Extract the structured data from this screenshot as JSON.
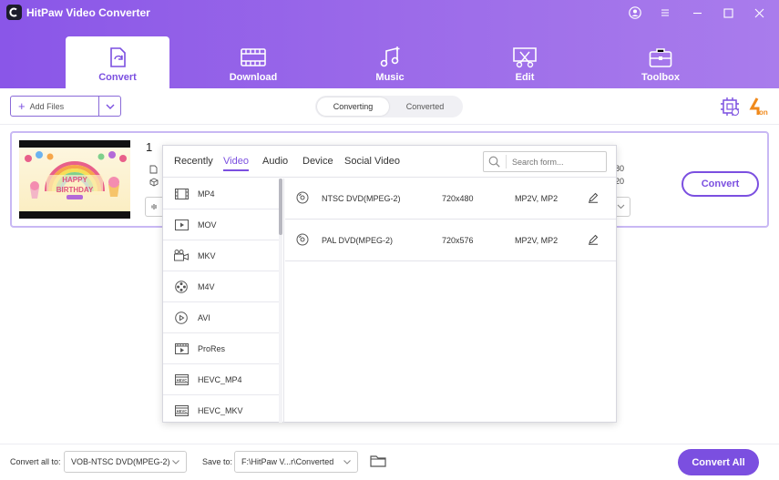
{
  "app": {
    "title": "HitPaw Video Converter"
  },
  "nav": {
    "tabs": [
      {
        "label": "Convert",
        "icon": "convert-icon",
        "active": true
      },
      {
        "label": "Download",
        "icon": "film-download-icon"
      },
      {
        "label": "Music",
        "icon": "music-note-icon"
      },
      {
        "label": "Edit",
        "icon": "scissors-icon"
      },
      {
        "label": "Toolbox",
        "icon": "toolbox-icon"
      }
    ]
  },
  "toolbar": {
    "add_files_label": "Add Files",
    "segments": [
      {
        "label": "Converting",
        "active": true
      },
      {
        "label": "Converted"
      }
    ]
  },
  "video": {
    "index": "1",
    "res_line1": "80",
    "res_line2": "20",
    "convert_label": "Convert"
  },
  "format_popup": {
    "tabs": [
      {
        "label": "Recently"
      },
      {
        "label": "Video",
        "active": true
      },
      {
        "label": "Audio"
      },
      {
        "label": "Device"
      },
      {
        "label": "Social Video"
      }
    ],
    "search_placeholder": "Search form...",
    "formats": [
      {
        "label": "MP4",
        "icon": "film-icon"
      },
      {
        "label": "MOV",
        "icon": "play-screen-icon"
      },
      {
        "label": "MKV",
        "icon": "camera-icon"
      },
      {
        "label": "M4V",
        "icon": "reel-icon"
      },
      {
        "label": "AVI",
        "icon": "play-circle-icon"
      },
      {
        "label": "ProRes",
        "icon": "prores-icon"
      },
      {
        "label": "HEVC_MP4",
        "icon": "hevc-icon"
      },
      {
        "label": "HEVC_MKV",
        "icon": "hevc-icon"
      }
    ],
    "presets": [
      {
        "name": "NTSC DVD(MPEG-2)",
        "resolution": "720x480",
        "codec": "MP2V, MP2"
      },
      {
        "name": "PAL DVD(MPEG-2)",
        "resolution": "720x576",
        "codec": "MP2V, MP2"
      }
    ]
  },
  "bottom": {
    "convert_all_to_label": "Convert all to:",
    "convert_all_to_value": "VOB-NTSC DVD(MPEG-2)",
    "save_to_label": "Save to:",
    "save_to_value": "F:\\HitPaw V...r\\Converted",
    "convert_all_button": "Convert All"
  },
  "colors": {
    "accent": "#7b4fe0",
    "header_start": "#8a56e8",
    "header_end": "#a97cec"
  }
}
